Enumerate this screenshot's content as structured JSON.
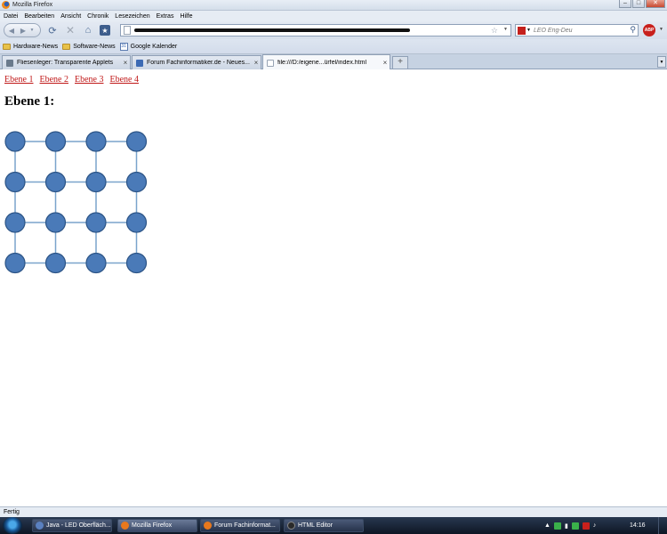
{
  "window": {
    "title": "Mozilla Firefox",
    "controls": [
      "–",
      "□",
      "✕"
    ]
  },
  "menu": [
    "Datei",
    "Bearbeiten",
    "Ansicht",
    "Chronik",
    "Lesezeichen",
    "Extras",
    "Hilfe"
  ],
  "search": {
    "placeholder": "LEO Eng-Deu"
  },
  "adblock": {
    "label": "ABP"
  },
  "bookmarks": [
    {
      "label": "Hardware-News",
      "icon": "folder-icon"
    },
    {
      "label": "Software-News",
      "icon": "folder-icon"
    },
    {
      "label": "Google Kalender",
      "icon": "calendar-icon"
    }
  ],
  "tabs": [
    {
      "label": "Fliesenleger: Transparente Applets",
      "active": false,
      "color": "#6a7a8c"
    },
    {
      "label": "Forum Fachinformatiker.de - Neues...",
      "active": false,
      "color": "#3c6ab4"
    },
    {
      "label": "file:///D:/eigene...ürfel/index.html",
      "active": true,
      "color": "#ffffff"
    }
  ],
  "page": {
    "nav_links": [
      "Ebene 1",
      "Ebene 2",
      "Ebene 3",
      "Ebene 4"
    ],
    "heading": "Ebene 1:",
    "grid": {
      "rows": 4,
      "cols": 4,
      "node_color": "#4a7ab8",
      "node_border": "#2c5486",
      "line_color": "#7aa4cc"
    }
  },
  "status": {
    "text": "Fertig"
  },
  "taskbar": {
    "items": [
      {
        "label": "Java - LED Oberfläch...",
        "active": false,
        "color": "#5a80c0"
      },
      {
        "label": "Mozilla Firefox",
        "active": true,
        "color": "#e8781c"
      },
      {
        "label": "Forum Fachinformat...",
        "active": false,
        "color": "#e8781c"
      },
      {
        "label": "HTML Editor",
        "active": false,
        "color": "#2a2a2a"
      }
    ],
    "clock": "14:16"
  }
}
